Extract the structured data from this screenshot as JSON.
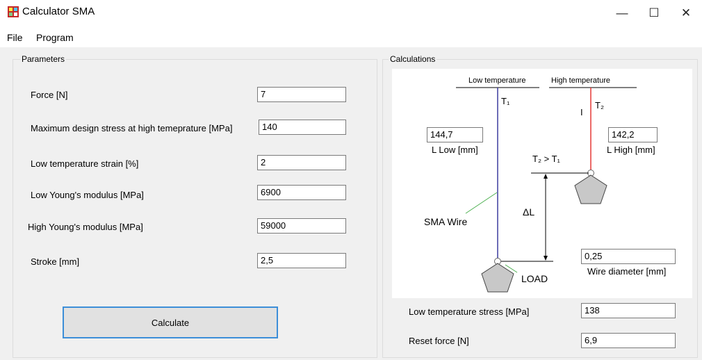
{
  "window": {
    "title": "Calculator SMA",
    "minimize_glyph": "—",
    "maximize_glyph": "☐",
    "close_glyph": "✕"
  },
  "menu": {
    "items": [
      "File",
      "Program"
    ]
  },
  "parameters": {
    "group_label": "Parameters",
    "fields": [
      {
        "label": "Force [N]",
        "value": "7"
      },
      {
        "label": "Maximum design stress at high temeprature [MPa]",
        "value": "140"
      },
      {
        "label": "Low temperature strain [%]",
        "value": "2"
      },
      {
        "label": "Low Young's modulus [MPa]",
        "value": "6900"
      },
      {
        "label": "High Young's modulus [MPa]",
        "value": "59000"
      },
      {
        "label": "Stroke [mm]",
        "value": "2,5"
      }
    ],
    "calculate_label": "Calculate"
  },
  "calculations": {
    "group_label": "Calculations",
    "diagram": {
      "low_temp_label": "Low temperature",
      "high_temp_label": "High temperature",
      "t1": "T₁",
      "t2": "T₂",
      "current_symbol": "I",
      "condition": "T₂ > T₁",
      "delta_l": "ΔL",
      "sma_wire": "SMA Wire",
      "load": "LOAD",
      "l_low_value": "144,7",
      "l_low_label": "L Low [mm]",
      "l_high_value": "142,2",
      "l_high_label": "L High [mm]",
      "wire_diameter_value": "0,25",
      "wire_diameter_label": "Wire diameter [mm]"
    },
    "results": [
      {
        "label": "Low temperature stress [MPa]",
        "value": "138"
      },
      {
        "label": "Reset force [N]",
        "value": "6,9"
      }
    ]
  },
  "colors": {
    "accent": "#3c8ed8",
    "hot_wire": "#e53935",
    "cold_wire": "#3b3b9e",
    "pointer": "#4caf50",
    "weight": "#c8c8c8"
  },
  "icons": [
    "app-icon",
    "minimize-icon",
    "maximize-icon",
    "close-icon"
  ]
}
